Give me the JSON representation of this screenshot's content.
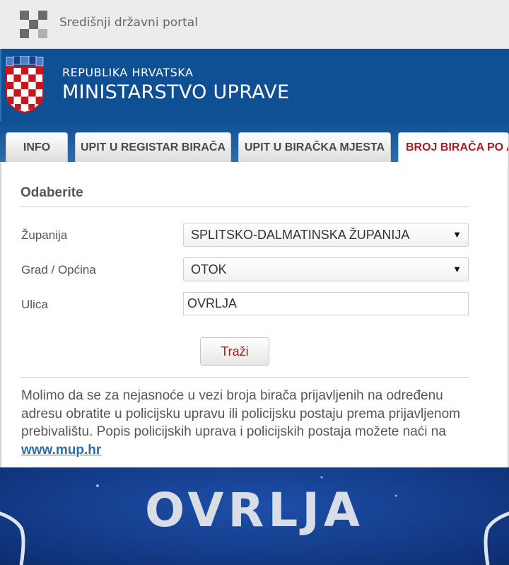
{
  "portal": {
    "title": "Središnji državni portal"
  },
  "header": {
    "subtitle": "REPUBLIKA HRVATSKA",
    "title": "MINISTARSTVO UPRAVE"
  },
  "tabs": [
    {
      "label": "INFO",
      "active": false
    },
    {
      "label": "UPIT U REGISTAR BIRAČA",
      "active": false
    },
    {
      "label": "UPIT U BIRAČKA MJESTA",
      "active": false
    },
    {
      "label": "BROJ BIRAČA PO A",
      "active": true
    }
  ],
  "form": {
    "section_title": "Odaberite",
    "county": {
      "label": "Županija",
      "value": "SPLITSKO-DALMATINSKA ŽUPANIJA"
    },
    "municipality": {
      "label": "Grad / Općina",
      "value": "OTOK"
    },
    "street": {
      "label": "Ulica",
      "value": "OVRLJA"
    },
    "search_button": "Traži"
  },
  "notice": {
    "text": "Molimo da se za nejasnoće u vezi broja birača prijavljenih na određenu adresu obratite u policijsku upravu ili policijsku postaju prema prijavljenom prebivalištu. Popis policijskih uprava i policijskih postaja možete naći na ",
    "link_text": "www.mup.hr"
  },
  "photo": {
    "sign_text": "OVRLJA"
  },
  "colors": {
    "header_blue": "#0f4f93",
    "accent_red": "#a51f1f",
    "link_blue": "#2e6dab"
  }
}
